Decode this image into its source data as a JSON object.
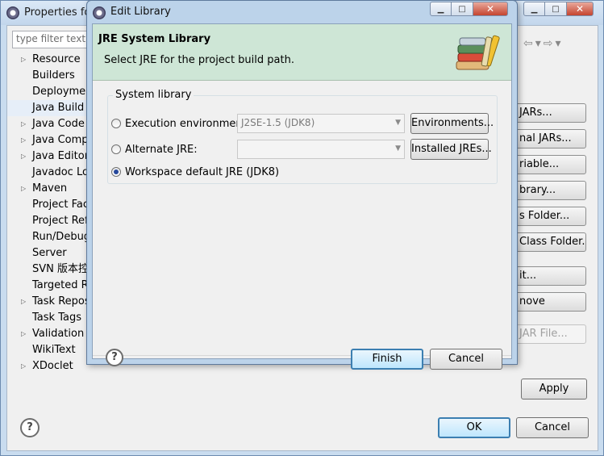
{
  "background_window": {
    "title": "Properties for",
    "filter_placeholder": "type filter text",
    "tree_items": [
      {
        "label": "Resource",
        "expandable": true
      },
      {
        "label": "Builders",
        "expandable": false
      },
      {
        "label": "Deployment",
        "expandable": false
      },
      {
        "label": "Java Build P",
        "expandable": false,
        "selected": true
      },
      {
        "label": "Java Code S",
        "expandable": true
      },
      {
        "label": "Java Compi",
        "expandable": true
      },
      {
        "label": "Java Editor",
        "expandable": true
      },
      {
        "label": "Javadoc Loc",
        "expandable": false
      },
      {
        "label": "Maven",
        "expandable": true
      },
      {
        "label": "Project Face",
        "expandable": false
      },
      {
        "label": "Project Refe",
        "expandable": false
      },
      {
        "label": "Run/Debug",
        "expandable": false
      },
      {
        "label": "Server",
        "expandable": false
      },
      {
        "label": "SVN 版本控",
        "expandable": false
      },
      {
        "label": "Targeted R",
        "expandable": false
      },
      {
        "label": "Task Repos",
        "expandable": true
      },
      {
        "label": "Task Tags",
        "expandable": false
      },
      {
        "label": "Validation",
        "expandable": true
      },
      {
        "label": "WikiText",
        "expandable": false
      },
      {
        "label": "XDoclet",
        "expandable": true
      }
    ],
    "right_buttons": [
      {
        "label": "JARs...",
        "disabled": false
      },
      {
        "label": "nal JARs...",
        "disabled": false
      },
      {
        "label": "riable...",
        "disabled": false
      },
      {
        "label": "brary...",
        "disabled": false
      },
      {
        "label": "s Folder...",
        "disabled": false
      },
      {
        "label": "Class Folder...",
        "disabled": false
      },
      {
        "label": "it...",
        "disabled": false
      },
      {
        "label": "nove",
        "disabled": false
      },
      {
        "label": "JAR File...",
        "disabled": true
      }
    ],
    "apply_label": "Apply",
    "ok_label": "OK",
    "cancel_label": "Cancel"
  },
  "dialog": {
    "title": "Edit Library",
    "banner_title": "JRE System Library",
    "banner_subtitle": "Select JRE for the project build path.",
    "group_label": "System library",
    "options": {
      "execution_env": {
        "label": "Execution environment:",
        "value": "J2SE-1.5 (JDK8)",
        "button": "Environments...",
        "checked": false
      },
      "alternate_jre": {
        "label": "Alternate JRE:",
        "value": "",
        "button": "Installed JREs...",
        "checked": false
      },
      "workspace_default": {
        "label": "Workspace default JRE (JDK8)",
        "checked": true
      }
    },
    "finish_label": "Finish",
    "cancel_label": "Cancel"
  },
  "help_glyph": "?",
  "icons": {
    "window_minimize": "minimize-icon",
    "window_maximize": "maximize-icon",
    "window_close": "close-icon",
    "books": "library-books-icon"
  }
}
